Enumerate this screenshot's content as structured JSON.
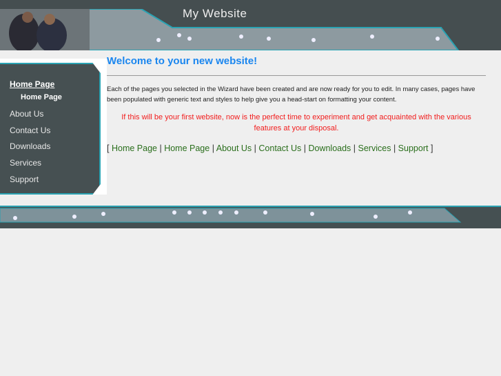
{
  "header": {
    "title": "My Website"
  },
  "sidebar": {
    "items": [
      {
        "label": "Home Page"
      },
      {
        "label": "Home Page"
      },
      {
        "label": "About Us"
      },
      {
        "label": "Contact Us"
      },
      {
        "label": "Downloads"
      },
      {
        "label": "Services"
      },
      {
        "label": "Support"
      }
    ]
  },
  "main": {
    "heading": "Welcome to your new website!",
    "intro": "Each of the pages you selected in the Wizard have been created and are now ready for you to edit. In many cases, pages have been populated with generic text and styles to help give you a head-start on formatting your content.",
    "notice": "If this will be your first website, now is the perfect time to experiment and get acquainted with the various features at your disposal.",
    "links": [
      "Home Page",
      "Home Page",
      "About Us",
      "Contact Us",
      "Downloads",
      "Services",
      "Support"
    ],
    "open_bracket": "[",
    "close_bracket": "]",
    "separator": "|"
  }
}
